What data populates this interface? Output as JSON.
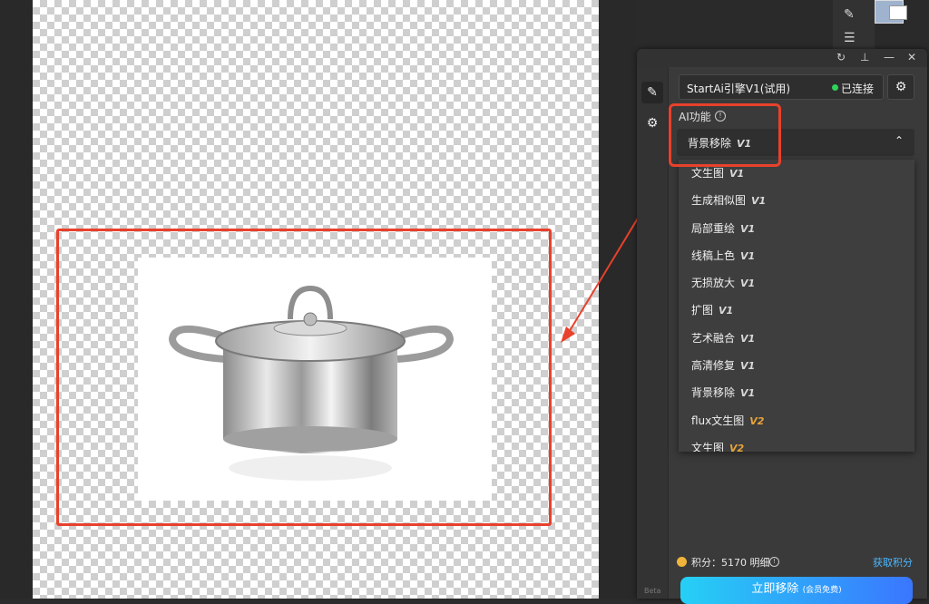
{
  "panel": {
    "toolbar_icons": [
      "refresh-icon",
      "pin-icon",
      "minimize-icon",
      "close-icon"
    ],
    "engine": {
      "name": "StartAi引擎V1(试用)",
      "status": "已连接"
    },
    "ai_function": {
      "label": "AI功能",
      "selected": {
        "name": "背景移除",
        "version": "V1"
      }
    },
    "dropdown_items": [
      {
        "name": "文生图",
        "version": "V1"
      },
      {
        "name": "生成相似图",
        "version": "V1"
      },
      {
        "name": "局部重绘",
        "version": "V1"
      },
      {
        "name": "线稿上色",
        "version": "V1"
      },
      {
        "name": "无损放大",
        "version": "V1"
      },
      {
        "name": "扩图",
        "version": "V1"
      },
      {
        "name": "艺术融合",
        "version": "V1"
      },
      {
        "name": "高清修复",
        "version": "V1"
      },
      {
        "name": "背景移除",
        "version": "V1"
      },
      {
        "name": "flux文生图",
        "version": "V2"
      },
      {
        "name": "文生图",
        "version": "V2"
      }
    ],
    "points": {
      "text": "积分：5170 明细",
      "get_label": "获取积分"
    },
    "action": {
      "label": "立即移除",
      "sub": "(会员免费)"
    },
    "beta": "Beta"
  },
  "colors": {
    "highlight": "#e8412c",
    "accent_start": "#26d0f5",
    "accent_end": "#3a76ff",
    "v2": "#e8a33c",
    "connected": "#2fd25a"
  }
}
